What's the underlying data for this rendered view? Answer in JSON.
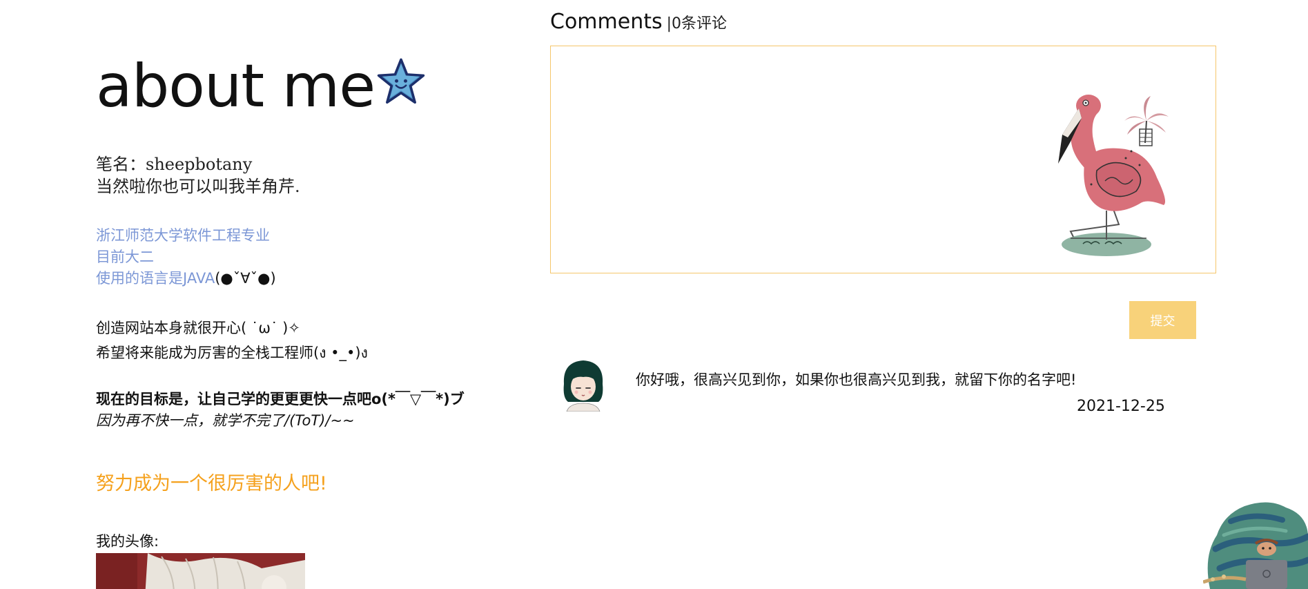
{
  "about": {
    "title": "about me",
    "penname_line1": "笔名：sheepbotany",
    "penname_line2": "当然啦你也可以叫我羊角芹.",
    "school": "浙江师范大学软件工程专业",
    "grade": "目前大二",
    "language_prefix": "使用的语言是JAVA",
    "language_suffix": "(●ˇ∀ˇ●)",
    "happy": "创造网站本身就很开心( ˙ω˙ )✧",
    "hope": "希望将来能成为厉害的全栈工程师(ง •_•)ง",
    "goal": "现在的目标是，让自己学的更更更快一点吧o(*￣▽￣*)ブ",
    "reason": "因为再不快一点，就学不完了/(ToT)/~~",
    "strive": "努力成为一个很厉害的人吧!",
    "avatar_label": "我的头像:"
  },
  "comments": {
    "title": "Comments",
    "count_label": "|0条评论",
    "textarea_placeholder": "",
    "submit_label": "提交",
    "items": [
      {
        "text": "你好哦，很高兴见到你，如果你也很高兴见到我，就留下你的名字吧!",
        "date": "2021-12-25"
      }
    ]
  },
  "colors": {
    "link_blue": "#7c97d6",
    "accent_orange": "#f5a11d",
    "box_border": "#f5c66a",
    "submit_bg": "#f8d27a"
  },
  "icons": [
    "star-face-icon",
    "flamingo-illustration",
    "girl-avatar-icon",
    "corner-character-illustration"
  ]
}
